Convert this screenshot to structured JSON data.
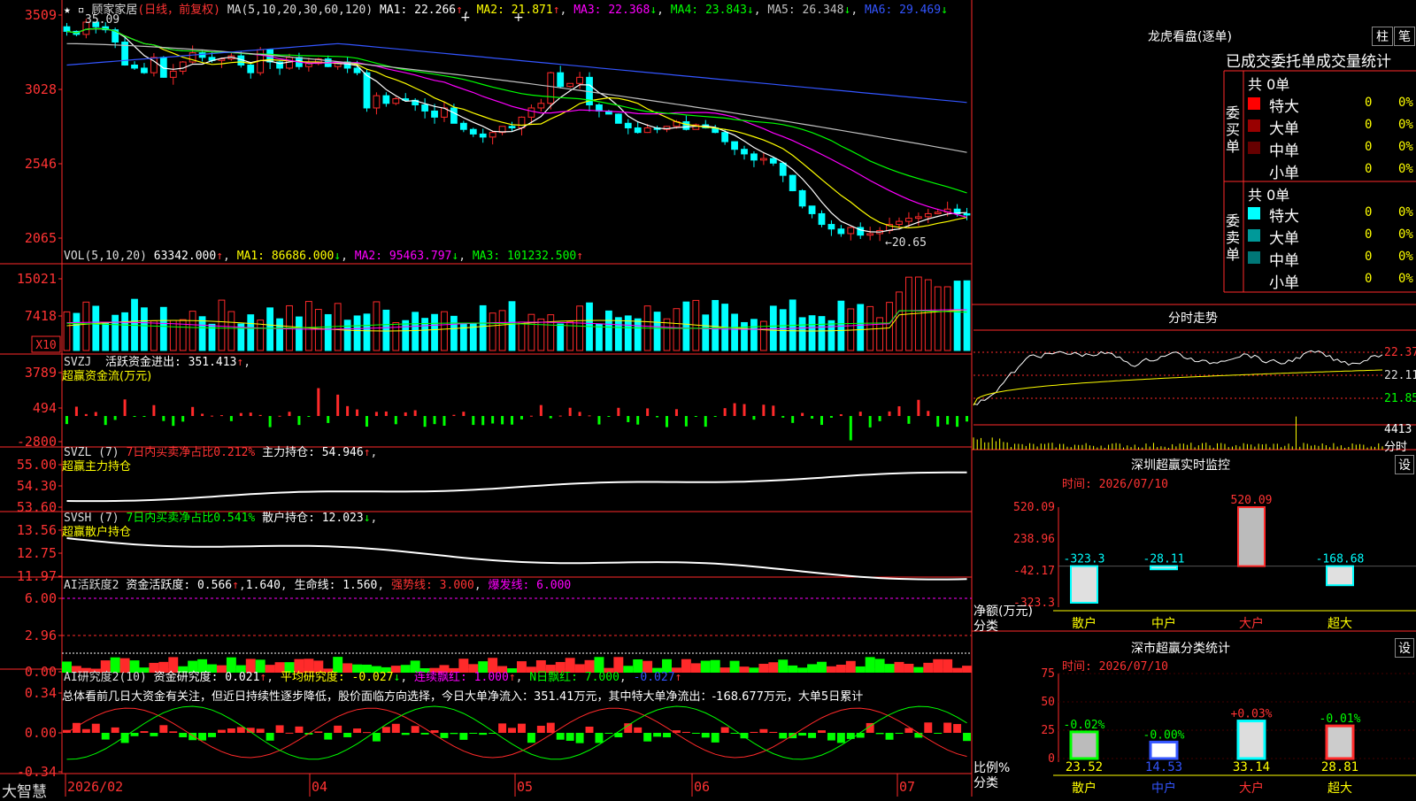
{
  "stock": {
    "title": "顾家家居",
    "mode": "(日线，前复权)"
  },
  "main_panel": {
    "ma_label": "MA(5,10,20,30,60,120)",
    "ma_values": [
      {
        "name": "MA1",
        "value": "22.266",
        "dir": "↑",
        "color": "#ffffff"
      },
      {
        "name": "MA2",
        "value": "21.871",
        "dir": "↑",
        "color": "#ffff00"
      },
      {
        "name": "MA3",
        "value": "22.368",
        "dir": "↓",
        "color": "#ff00ff"
      },
      {
        "name": "MA4",
        "value": "23.843",
        "dir": "↓",
        "color": "#00ff00"
      },
      {
        "name": "MA5",
        "value": "26.348",
        "dir": "↓",
        "color": "#c0c0c0"
      },
      {
        "name": "MA6",
        "value": "29.469",
        "dir": "↓",
        "color": "#3355ff"
      }
    ],
    "yticks": [
      "3509",
      "3028",
      "2546",
      "2065"
    ],
    "high_label": "35.09",
    "low_label": "←20.65"
  },
  "vol_panel": {
    "label": "VOL(5,10,20)",
    "value": "63342.000",
    "mas": [
      {
        "name": "MA1",
        "value": "86686.000",
        "dir": "↓",
        "color": "#ffff00"
      },
      {
        "name": "MA2",
        "value": "95463.797",
        "dir": "↓",
        "color": "#ff00ff"
      },
      {
        "name": "MA3",
        "value": "101232.500",
        "dir": "↑",
        "color": "#00ff00"
      }
    ],
    "yticks": [
      "15021",
      "7418"
    ],
    "unit": "X10"
  },
  "svzj_panel": {
    "label": "SVZJ",
    "text": "活跃资金进出: 351.413",
    "sub": "超赢资金流(万元)",
    "yticks": [
      "3789",
      "494",
      "-2800"
    ]
  },
  "svzl_panel": {
    "label": "SVZL (7)",
    "ratio": "7日内买卖净占比0.212%",
    "text": "主力持仓: 54.946",
    "sub": "超赢主力持仓",
    "yticks": [
      "55.00",
      "54.30",
      "53.60"
    ]
  },
  "svsh_panel": {
    "label": "SVSH (7)",
    "ratio": "7日内买卖净占比0.541%",
    "text": "散户持仓: 12.023",
    "sub": "超赢散户持仓",
    "yticks": [
      "13.56",
      "12.75",
      "11.97"
    ]
  },
  "ai1_panel": {
    "label": "AI活跃度2",
    "text": "资金活跃度: 0.566",
    "v2": "1.640",
    "life": "生命线: 1.560",
    "strong": "强势线: 3.000",
    "burst": "爆发线: 6.000",
    "yticks": [
      "6.00",
      "2.96",
      "0.00"
    ]
  },
  "ai2_panel": {
    "label": "AI研究度2(10)",
    "text": "资金研究度: 0.021",
    "avg": "平均研究度: -0.027",
    "lianxu": "连续飘红: 1.000",
    "nday": "N日飘红: 7.000",
    "last": "-0.027",
    "desc": "总体看前几日大资金有关注，但近日持续性逐步降低，股价面临方向选择，今日大单净流入：351.41万元，其中特大单净流出：-168.677万元，大单5日累计",
    "yticks": [
      "0.34",
      "0.00",
      "-0.34"
    ]
  },
  "xaxis": {
    "labels": [
      "2026/02",
      "04",
      "05",
      "06",
      "07"
    ]
  },
  "brand": "大智慧",
  "right": {
    "lhb_title": "龙虎看盘(逐单)",
    "btn_zhu": "柱",
    "btn_bi": "笔",
    "table_header": "已成交委托单成交量统计",
    "buy": {
      "label": "委买单",
      "total": "共 0单",
      "rows": [
        {
          "name": "特大",
          "value": "0",
          "pct": "0%",
          "color": "#ff0000"
        },
        {
          "name": "大单",
          "value": "0",
          "pct": "0%",
          "color": "#990000"
        },
        {
          "name": "中单",
          "value": "0",
          "pct": "0%",
          "color": "#660000"
        },
        {
          "name": "小单",
          "value": "0",
          "pct": "0%",
          "color": "#000000"
        }
      ]
    },
    "sell": {
      "label": "委卖单",
      "total": "共 0单",
      "rows": [
        {
          "name": "特大",
          "value": "0",
          "pct": "0%",
          "color": "#00ffff"
        },
        {
          "name": "大单",
          "value": "0",
          "pct": "0%",
          "color": "#009999"
        },
        {
          "name": "中单",
          "value": "0",
          "pct": "0%",
          "color": "#007777"
        },
        {
          "name": "小单",
          "value": "0",
          "pct": "0%",
          "color": "#000000"
        }
      ]
    },
    "fenshi_title": "分时走势",
    "fenshi_yticks": [
      "22.37",
      "22.11",
      "21.85"
    ],
    "fenshi_vol": "4413",
    "fenshi_vol_unit": "分时",
    "monitor_title": "深圳超赢实时监控",
    "btn_set": "设",
    "monitor_time": "时间: 2026/07/10",
    "monitor_yticks": [
      "520.09",
      "238.96",
      "-42.17",
      "-323.3"
    ],
    "monitor_ylabel": "净额(万元)",
    "monitor_xlabel": "分类",
    "categories": [
      "散户",
      "中户",
      "大户",
      "超大"
    ],
    "stat_title": "深市超赢分类统计",
    "btn_set2": "设",
    "stat_time": "时间: 2026/07/10",
    "stat_yticks": [
      "75",
      "50",
      "25",
      "0"
    ],
    "stat_ylabel": "比例%",
    "stat_xlabel": "分类"
  },
  "chart_data": [
    {
      "type": "candlestick",
      "title": "顾家家居 (日线，前复权)",
      "ylim": [
        20.65,
        35.09
      ],
      "ohlc_note": "approximate daily closes read from chart",
      "closes": [
        34.2,
        34.0,
        34.8,
        34.5,
        34.3,
        33.5,
        32.0,
        31.8,
        31.5,
        32.5,
        31.2,
        31.6,
        32.2,
        32.8,
        32.5,
        32.3,
        32.4,
        32.6,
        32.0,
        31.5,
        33.0,
        32.2,
        31.8,
        32.5,
        31.9,
        32.1,
        32.4,
        31.9,
        32.2,
        31.8,
        31.5,
        29.2,
        30.0,
        29.5,
        29.8,
        29.7,
        29.4,
        29.0,
        28.6,
        29.2,
        28.2,
        27.8,
        27.5,
        27.3,
        27.6,
        28.0,
        27.9,
        28.6,
        29.2,
        29.5,
        31.5,
        30.6,
        30.8,
        31.2,
        29.4,
        29.0,
        28.8,
        28.2,
        27.9,
        27.6,
        27.9,
        27.8,
        28.0,
        28.3,
        27.8,
        28.1,
        27.9,
        27.6,
        27.0,
        26.5,
        26.2,
        25.8,
        25.9,
        25.6,
        24.8,
        23.8,
        22.8,
        22.3,
        21.6,
        21.3,
        21.0,
        21.4,
        20.9,
        21.0,
        21.2,
        21.6,
        21.8,
        22.0,
        22.1,
        22.3,
        22.4,
        22.6,
        22.3,
        22.26
      ],
      "series": [
        {
          "name": "MA1",
          "values": "5-day moving average of closes"
        },
        {
          "name": "MA6",
          "start": 33.8,
          "end": 30.8
        }
      ]
    },
    {
      "type": "bar",
      "title": "深圳超赢实时监控",
      "categories": [
        "散户",
        "中户",
        "大户",
        "超大"
      ],
      "values": [
        -323.3,
        -28.11,
        520.09,
        -168.68
      ],
      "ylim": [
        -323.3,
        520.09
      ]
    },
    {
      "type": "bar",
      "title": "深市超赢分类统计",
      "categories": [
        "散户",
        "中户",
        "大户",
        "超大"
      ],
      "values": [
        23.52,
        14.53,
        33.14,
        28.81
      ],
      "changes": [
        "-0.02%",
        "-0.00%",
        "+0.03%",
        "-0.01%"
      ],
      "ylim": [
        0,
        75
      ]
    }
  ]
}
